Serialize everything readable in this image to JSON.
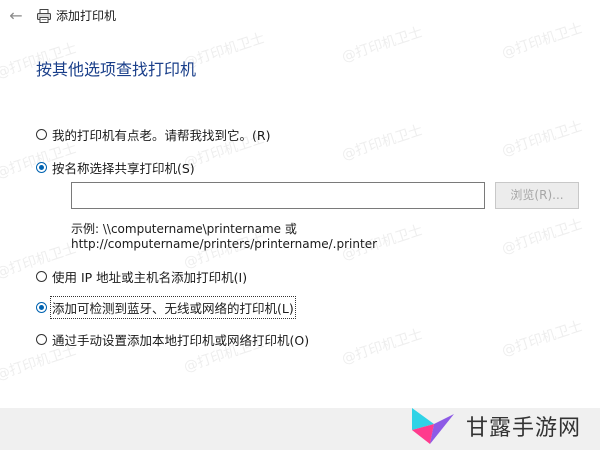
{
  "window": {
    "title": "添加打印机",
    "back_icon": "back-arrow-icon",
    "printer_icon": "printer-icon"
  },
  "heading": "按其他选项查找打印机",
  "options": [
    {
      "label": "我的打印机有点老。请帮我找到它。(R)",
      "checked": false
    },
    {
      "label": "按名称选择共享打印机(S)",
      "checked": true
    },
    {
      "label": "使用 IP 地址或主机名添加打印机(I)",
      "checked": false
    },
    {
      "label": "添加可检测到蓝牙、无线或网络的打印机(L)",
      "checked": true
    },
    {
      "label": "通过手动设置添加本地打印机或网络打印机(O)",
      "checked": false
    }
  ],
  "shared_printer": {
    "input_value": "",
    "browse_label": "浏览(R)...",
    "example_line1": "示例: \\\\computername\\printername 或",
    "example_line2": "http://computername/printers/printername/.printer"
  },
  "watermark_text": "@打印机卫士",
  "brand": {
    "name": "甘露手游网",
    "colors": {
      "cyan": "#2fd3e6",
      "pink": "#ff3b8d",
      "purple": "#7b3fe4"
    }
  },
  "colors": {
    "heading": "#1a3f8a",
    "accent": "#0063b1",
    "footer": "#f0f0f0"
  }
}
